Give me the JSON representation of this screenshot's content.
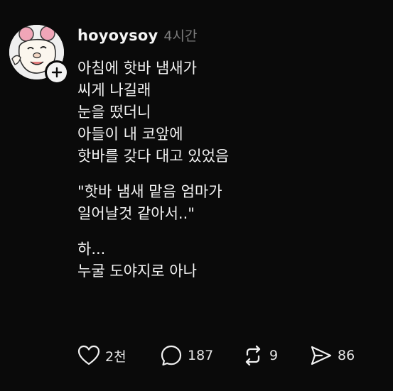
{
  "post": {
    "username": "hoyoysoy",
    "timestamp": "4시간",
    "paragraphs": [
      [
        "아침에 핫바 냄새가",
        "씨게 나길래",
        "눈을 떴더니",
        "아들이 내 코앞에",
        "핫바를 갖다 대고 있었음"
      ],
      [
        "\"핫바 냄새 맡음 엄마가",
        "일어날것 같아서..\""
      ],
      [
        "하...",
        "누굴 도야지로 아나"
      ]
    ]
  },
  "actions": {
    "like_count": "2천",
    "reply_count": "187",
    "repost_count": "9",
    "share_count": "86"
  },
  "icons": {
    "avatar": "cartoon-face-avatar",
    "follow": "plus-icon",
    "like": "heart-icon",
    "reply": "speech-bubble-icon",
    "repost": "repost-arrows-icon",
    "share": "paper-plane-icon"
  },
  "colors": {
    "background": "#0a0a0a",
    "text": "#f3f3f3",
    "muted": "#7d7d7d",
    "avatar_accent": "#f0a6b8"
  }
}
